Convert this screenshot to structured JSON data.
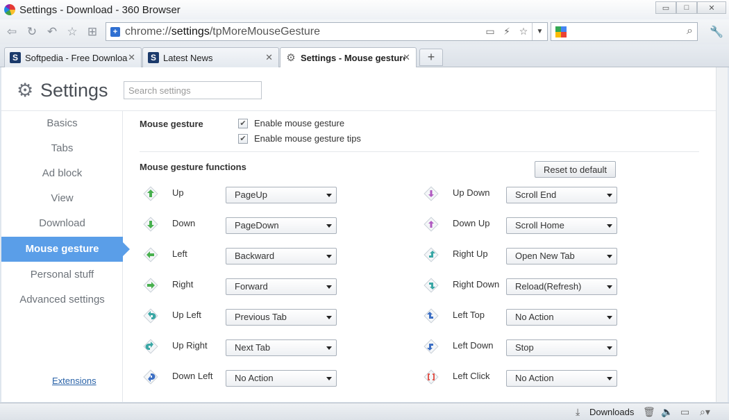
{
  "window": {
    "title": "Settings - Download - 360 Browser",
    "controls": {
      "minimize": "▭",
      "maximize": "□",
      "close": "✕"
    }
  },
  "toolbar": {
    "url_prefix": "chrome://",
    "url_bold": "settings",
    "url_suffix": "/tpMoreMouseGesture",
    "icons": [
      "back-icon",
      "forward-icon",
      "refresh-icon",
      "home-icon",
      "favorites-icon",
      "apps-icon"
    ]
  },
  "tabs": [
    {
      "label": "Softpedia - Free Downloa",
      "favicon": "S"
    },
    {
      "label": "Latest News",
      "favicon": "S"
    },
    {
      "label": "Settings - Mouse gesture",
      "favicon": "⚙"
    }
  ],
  "new_tab": "+",
  "settings": {
    "title": "Settings",
    "search_placeholder": "Search settings"
  },
  "sidebar": {
    "items": [
      {
        "label": "Basics"
      },
      {
        "label": "Tabs"
      },
      {
        "label": "Ad block"
      },
      {
        "label": "View"
      },
      {
        "label": "Download"
      },
      {
        "label": "Mouse gesture",
        "active": true
      },
      {
        "label": "Personal stuff"
      },
      {
        "label": "Advanced settings"
      }
    ],
    "extensions_link": "Extensions"
  },
  "mouse_gesture": {
    "section_title": "Mouse gesture",
    "enable_label": "Enable mouse gesture",
    "tips_label": "Enable mouse gesture tips"
  },
  "functions": {
    "section_title": "Mouse gesture functions",
    "reset_label": "Reset to default",
    "left": [
      {
        "label": "Up",
        "action": "PageUp",
        "icon": "arrow-up-icon",
        "color": "#48b04f"
      },
      {
        "label": "Down",
        "action": "PageDown",
        "icon": "arrow-down-icon",
        "color": "#48b04f"
      },
      {
        "label": "Left",
        "action": "Backward",
        "icon": "arrow-left-icon",
        "color": "#48b04f"
      },
      {
        "label": "Right",
        "action": "Forward",
        "icon": "arrow-right-icon",
        "color": "#48b04f"
      },
      {
        "label": "Up Left",
        "action": "Previous Tab",
        "icon": "arrow-up-left-icon",
        "color": "#3aa7a5"
      },
      {
        "label": "Up Right",
        "action": "Next Tab",
        "icon": "arrow-up-right-icon",
        "color": "#3aa7a5"
      },
      {
        "label": "Down Left",
        "action": "No Action",
        "icon": "arrow-down-left-icon",
        "color": "#3c6fc4"
      }
    ],
    "right": [
      {
        "label": "Up Down",
        "action": "Scroll End",
        "icon": "up-down-icon",
        "color": "#b05bc1"
      },
      {
        "label": "Down Up",
        "action": "Scroll Home",
        "icon": "down-up-icon",
        "color": "#b05bc1"
      },
      {
        "label": "Right Up",
        "action": "Open New Tab",
        "icon": "right-up-icon",
        "color": "#3aa7a5"
      },
      {
        "label": "Right Down",
        "action": "Reload(Refresh)",
        "icon": "right-down-icon",
        "color": "#3aa7a5"
      },
      {
        "label": "Left Top",
        "action": "No Action",
        "icon": "left-top-icon",
        "color": "#3c6fc4"
      },
      {
        "label": "Left Down",
        "action": "Stop",
        "icon": "left-down-icon",
        "color": "#3c6fc4"
      },
      {
        "label": "Left Click",
        "action": "No Action",
        "icon": "left-click-icon",
        "color": "#e0584f"
      }
    ]
  },
  "statusbar": {
    "downloads_label": "Downloads"
  }
}
